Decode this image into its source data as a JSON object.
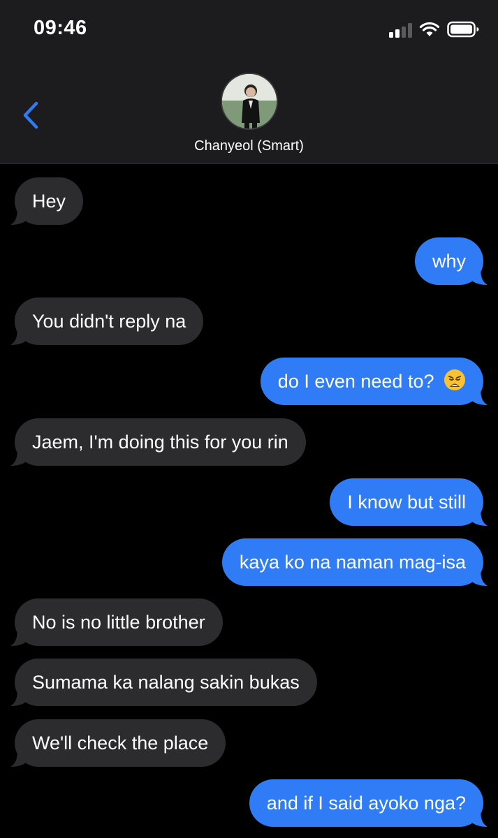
{
  "status_bar": {
    "time": "09:46",
    "signal_icon": "cellular-signal-icon",
    "wifi_icon": "wifi-icon",
    "battery_icon": "battery-icon"
  },
  "header": {
    "back_icon": "chevron-left-icon",
    "contact_name": "Chanyeol (Smart)"
  },
  "colors": {
    "incoming_bubble": "#2c2c2e",
    "outgoing_bubble": "#2f7cf6",
    "accent": "#2f7cf6",
    "background": "#000000"
  },
  "messages": [
    {
      "direction": "incoming",
      "text": "Hey"
    },
    {
      "direction": "outgoing",
      "text": "why"
    },
    {
      "direction": "incoming",
      "text": "You didn't reply na"
    },
    {
      "direction": "outgoing",
      "text": "do I even need to?",
      "emoji": "weary-face-emoji"
    },
    {
      "direction": "incoming",
      "text": "Jaem, I'm doing this for you rin"
    },
    {
      "direction": "outgoing",
      "text": "I know but still"
    },
    {
      "direction": "outgoing",
      "text": "kaya ko na naman mag-isa"
    },
    {
      "direction": "incoming",
      "text": "No is no little brother"
    },
    {
      "direction": "incoming",
      "text": "Sumama ka nalang sakin bukas"
    },
    {
      "direction": "incoming",
      "text": "We'll check the place"
    },
    {
      "direction": "outgoing",
      "text": "and if I said ayoko nga?"
    }
  ]
}
